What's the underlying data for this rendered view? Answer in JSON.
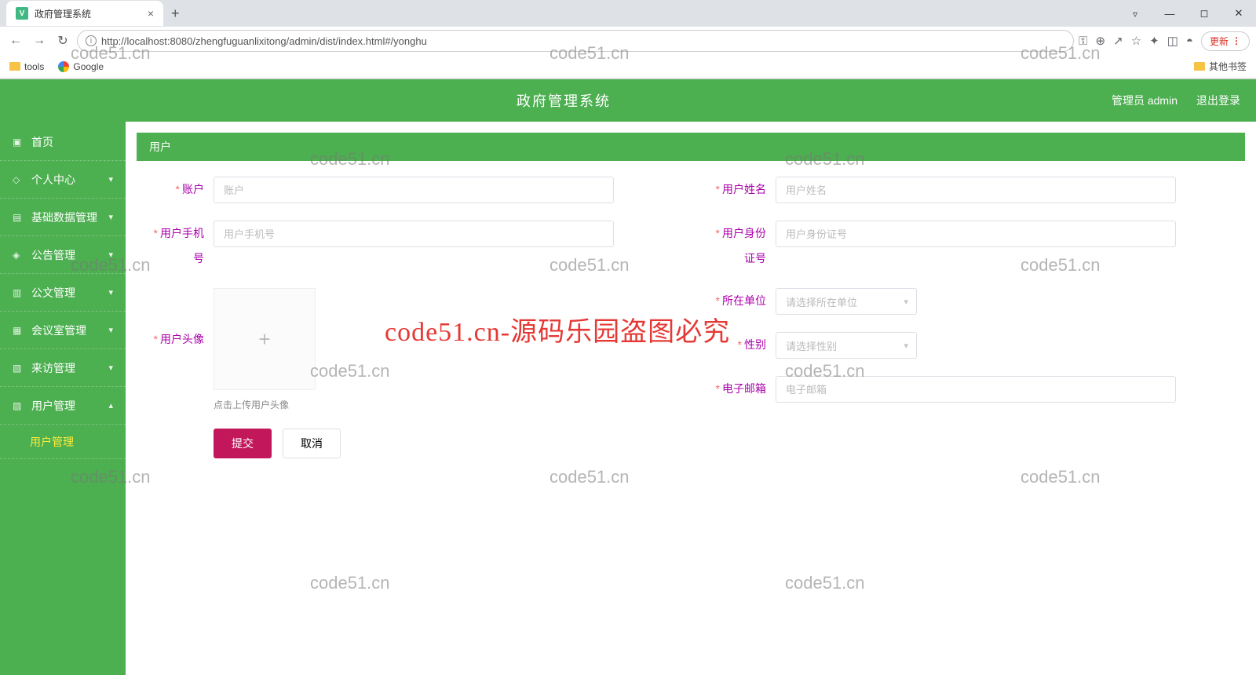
{
  "browser": {
    "tab_title": "政府管理系统",
    "url": "http://localhost:8080/zhengfuguanlixitong/admin/dist/index.html#/yonghu",
    "update_label": "更新",
    "bookmarks": {
      "tools": "tools",
      "google": "Google",
      "other": "其他书签"
    }
  },
  "header": {
    "title": "政府管理系统",
    "user_label": "管理员 admin",
    "logout": "退出登录"
  },
  "sidebar": {
    "items": [
      {
        "label": "首页",
        "icon": "▣",
        "expandable": false
      },
      {
        "label": "个人中心",
        "icon": "◇",
        "expandable": true,
        "open": false
      },
      {
        "label": "基础数据管理",
        "icon": "▤",
        "expandable": true,
        "open": false
      },
      {
        "label": "公告管理",
        "icon": "◈",
        "expandable": true,
        "open": false
      },
      {
        "label": "公文管理",
        "icon": "▥",
        "expandable": true,
        "open": false
      },
      {
        "label": "会议室管理",
        "icon": "▦",
        "expandable": true,
        "open": false
      },
      {
        "label": "来访管理",
        "icon": "▧",
        "expandable": true,
        "open": false
      },
      {
        "label": "用户管理",
        "icon": "▨",
        "expandable": true,
        "open": true
      }
    ],
    "submenu_active": "用户管理"
  },
  "panel": {
    "title": "用户"
  },
  "form": {
    "account": {
      "label": "账户",
      "placeholder": "账户"
    },
    "username": {
      "label": "用户姓名",
      "placeholder": "用户姓名"
    },
    "phone": {
      "label": "用户手机号",
      "placeholder": "用户手机号"
    },
    "idcard": {
      "label": "用户身份证号",
      "placeholder": "用户身份证号"
    },
    "avatar": {
      "label": "用户头像",
      "hint": "点击上传用户头像"
    },
    "dept": {
      "label": "所在单位",
      "placeholder": "请选择所在单位"
    },
    "gender": {
      "label": "性别",
      "placeholder": "请选择性别"
    },
    "email": {
      "label": "电子邮箱",
      "placeholder": "电子邮箱"
    },
    "submit": "提交",
    "cancel": "取消"
  },
  "watermark": {
    "small": "code51.cn",
    "big": "code51.cn-源码乐园盗图必究"
  }
}
